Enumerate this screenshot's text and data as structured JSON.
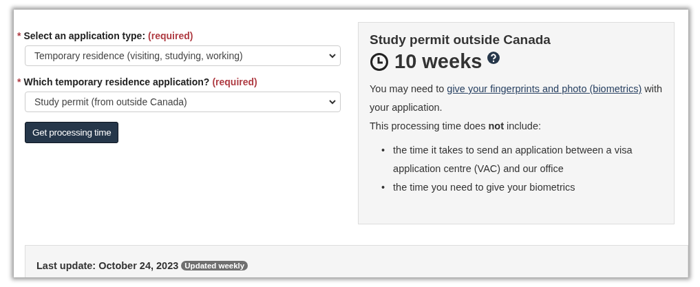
{
  "form": {
    "fields": [
      {
        "marker": "*",
        "label": "Select an application type:",
        "required_note": "(required)",
        "value": "Temporary residence (visiting, studying, working)"
      },
      {
        "marker": "*",
        "label": "Which temporary residence application?",
        "required_note": "(required)",
        "value": "Study permit (from outside Canada)"
      }
    ],
    "button": "Get processing time"
  },
  "result": {
    "title": "Study permit outside Canada",
    "time": "10 weeks",
    "intro": {
      "before": "You may need to",
      "link": "give your fingerprints and photo (biometrics)",
      "after": "with your application."
    },
    "note": "This processing time does **not** include:",
    "bullets": [
      {
        "marker": "•",
        "text": "the time it takes to send an application between a visa application centre (VAC) and our office"
      },
      {
        "marker": "•",
        "text": "the time you need to give your biometrics"
      }
    ]
  },
  "last_update": {
    "text": "Last update: October 24, 2023",
    "badge": "Updated weekly"
  }
}
